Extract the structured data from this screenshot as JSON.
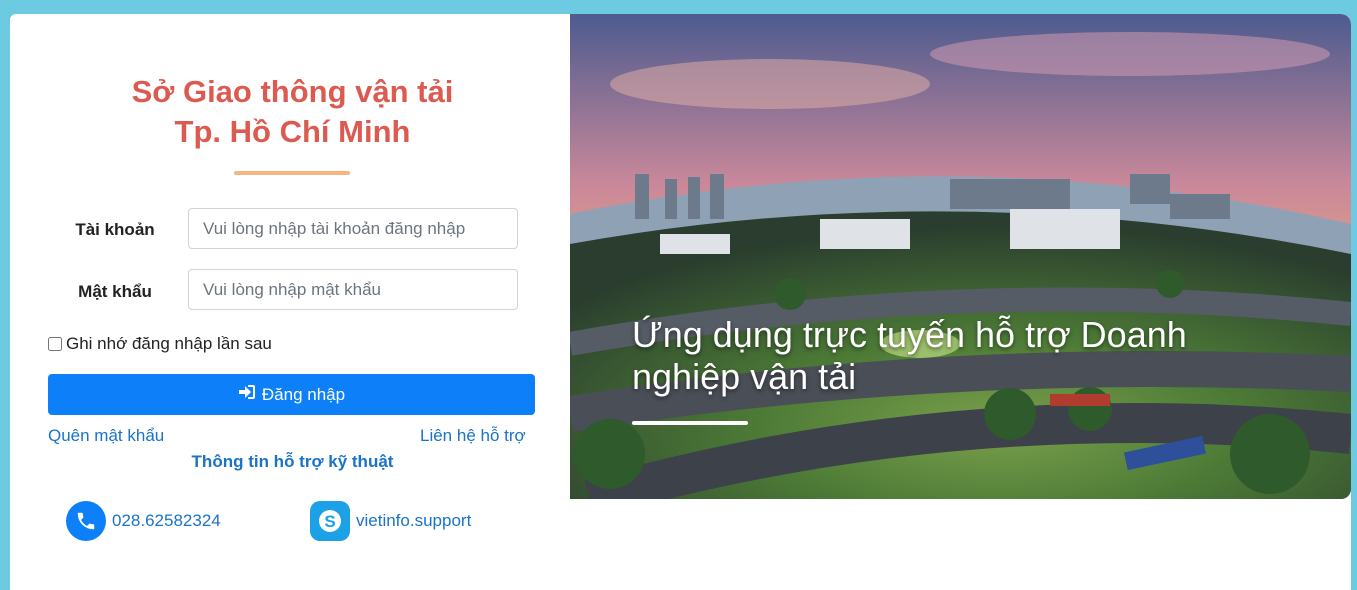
{
  "header": {
    "title_line1": "Sở Giao thông vận tải",
    "title_line2": "Tp. Hồ Chí Minh"
  },
  "form": {
    "account_label": "Tài khoản",
    "account_placeholder": "Vui lòng nhập tài khoản đăng nhập",
    "password_label": "Mật khẩu",
    "password_placeholder": "Vui lòng nhập mật khẩu",
    "remember_label": "Ghi nhớ đăng nhập lần sau",
    "login_label": "Đăng nhập",
    "forgot_label": "Quên mật khẩu",
    "contact_label": "Liên hệ hỗ trợ"
  },
  "support": {
    "title": "Thông tin hỗ trợ kỹ thuật",
    "phone": "028.62582324",
    "skype": "vietinfo.support"
  },
  "hero": {
    "caption": "Ứng dụng trực tuyến hỗ trợ Doanh nghiệp vận tải"
  },
  "colors": {
    "title": "#dc5a50",
    "accent_line": "#f5b482",
    "primary": "#0d7ff9",
    "link": "#1a73c8",
    "frame_bg": "#6ccbe0"
  },
  "icons": {
    "login": "sign-in-icon",
    "phone": "phone-icon",
    "skype": "skype-icon"
  }
}
